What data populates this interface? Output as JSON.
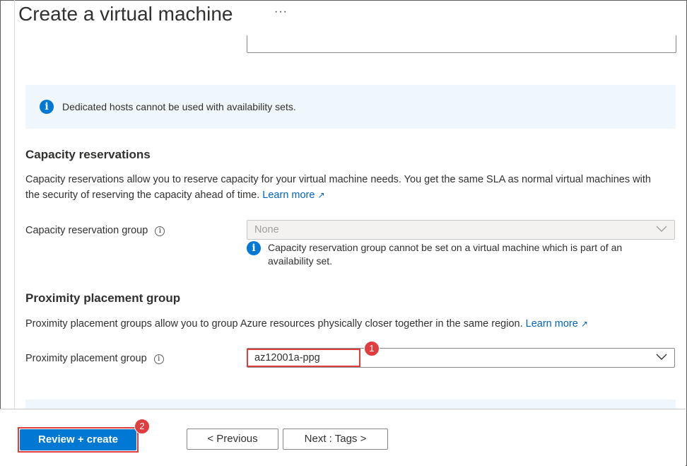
{
  "header": {
    "title": "Create a virtual machine",
    "more_label": "···"
  },
  "info_banner": {
    "icon": "info-icon",
    "text": "Dedicated hosts cannot be used with availability sets."
  },
  "capacity": {
    "title": "Capacity reservations",
    "description": "Capacity reservations allow you to reserve capacity for your virtual machine needs. You get the same SLA as normal virtual machines with the security of reserving the capacity ahead of time.",
    "learn_more": "Learn more",
    "field_label": "Capacity reservation group",
    "field_value": "None",
    "note": "Capacity reservation group cannot be set on a virtual machine which is part of an availability set."
  },
  "proximity": {
    "title": "Proximity placement group",
    "description": "Proximity placement groups allow you to group Azure resources physically closer together in the same region.",
    "learn_more": "Learn more",
    "field_label": "Proximity placement group",
    "field_value": "az12001a-ppg"
  },
  "annotations": {
    "badge_1": "1",
    "badge_2": "2"
  },
  "footer": {
    "review_create": "Review + create",
    "previous": "< Previous",
    "next": "Next : Tags >"
  },
  "colors": {
    "accent": "#0078d4",
    "highlight": "#e03e3e",
    "banner_bg": "#eff6fc"
  }
}
